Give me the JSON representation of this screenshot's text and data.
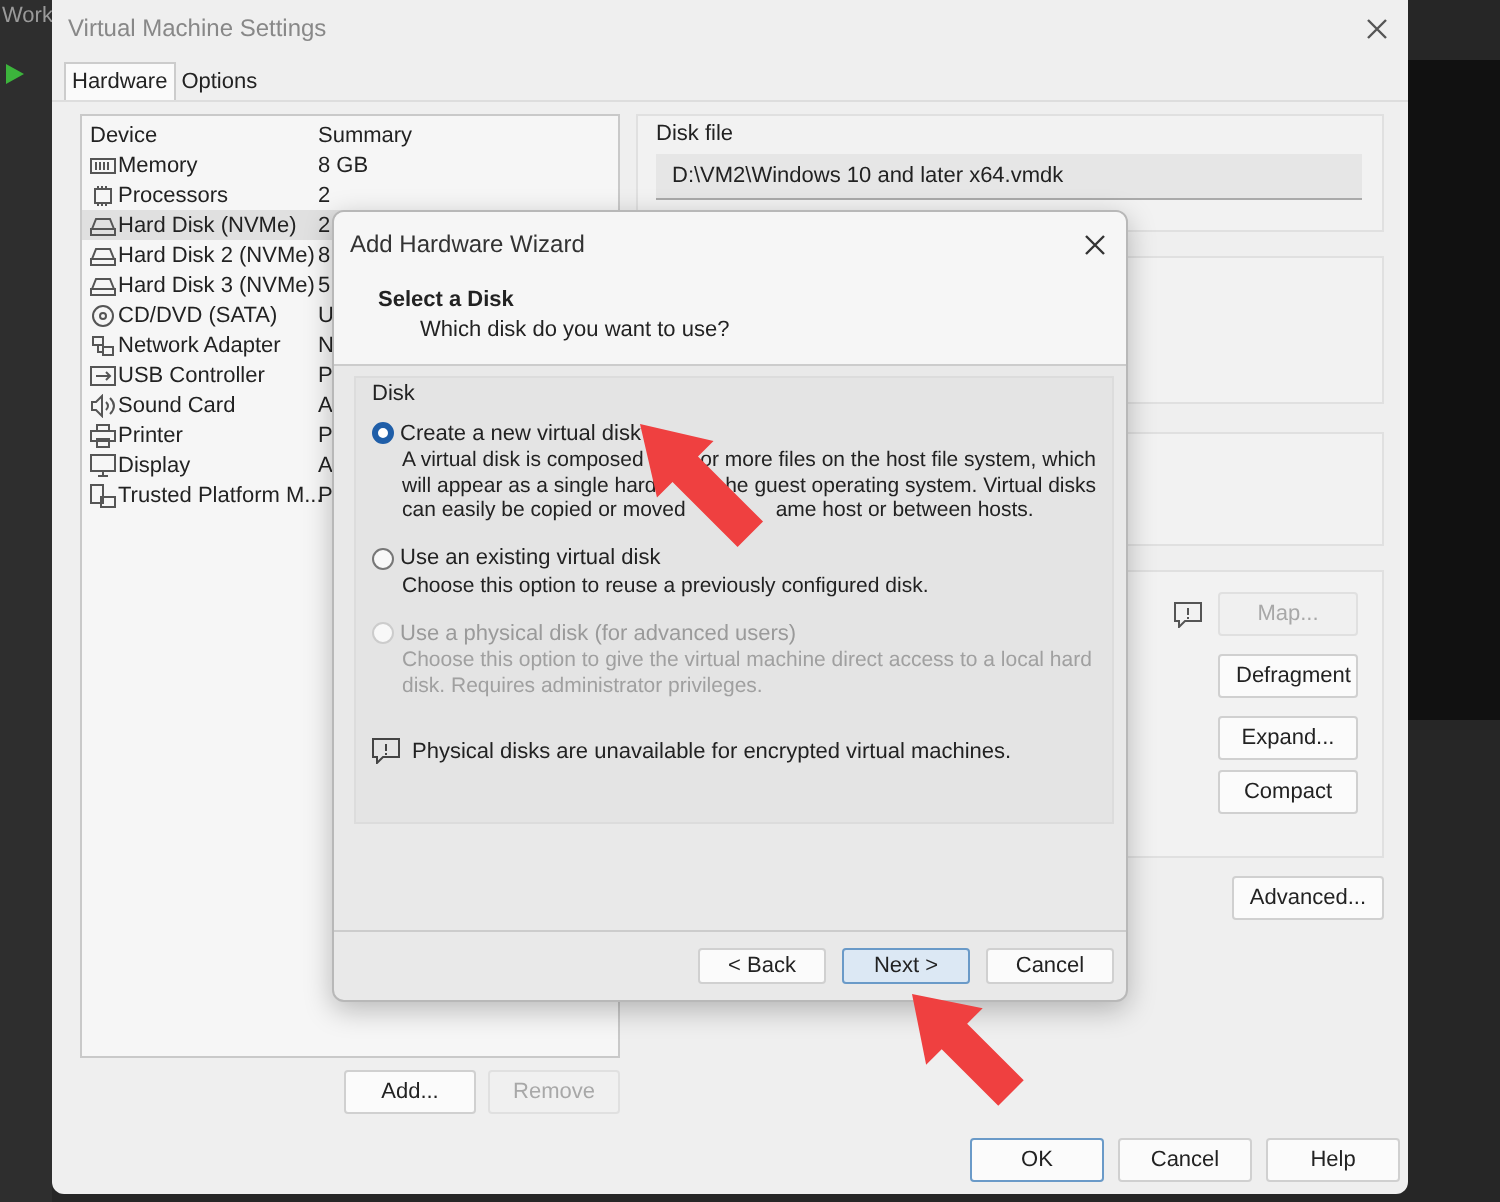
{
  "background_app": {
    "title": "Work"
  },
  "window": {
    "title": "Virtual Machine Settings",
    "tabs": [
      {
        "label": "Hardware",
        "selected": true
      },
      {
        "label": "Options",
        "selected": false
      }
    ],
    "devices": {
      "columns": [
        "Device",
        "Summary"
      ],
      "rows": [
        {
          "kind": "memory",
          "name": "Memory",
          "summary": "8 GB",
          "selected": false
        },
        {
          "kind": "cpu",
          "name": "Processors",
          "summary": "2",
          "selected": false
        },
        {
          "kind": "disk",
          "name": "Hard Disk (NVMe)",
          "summary": "2",
          "selected": true
        },
        {
          "kind": "disk",
          "name": "Hard Disk 2 (NVMe)",
          "summary": "8",
          "selected": false
        },
        {
          "kind": "disk",
          "name": "Hard Disk 3 (NVMe)",
          "summary": "5",
          "selected": false
        },
        {
          "kind": "cd",
          "name": "CD/DVD (SATA)",
          "summary": "U",
          "selected": false
        },
        {
          "kind": "network",
          "name": "Network Adapter",
          "summary": "N",
          "selected": false
        },
        {
          "kind": "usb",
          "name": "USB Controller",
          "summary": "P",
          "selected": false
        },
        {
          "kind": "sound",
          "name": "Sound Card",
          "summary": "A",
          "selected": false
        },
        {
          "kind": "printer",
          "name": "Printer",
          "summary": "P",
          "selected": false
        },
        {
          "kind": "display",
          "name": "Display",
          "summary": "A",
          "selected": false
        },
        {
          "kind": "tpm",
          "name": "Trusted Platform M...",
          "summary": "P",
          "selected": false
        }
      ]
    },
    "list_buttons": [
      {
        "label": "Add...",
        "disabled": false
      },
      {
        "label": "Remove",
        "disabled": true
      }
    ],
    "disk_file": {
      "label": "Disk file",
      "value": "D:\\VM2\\Windows 10 and later x64.vmdk"
    },
    "utility_buttons": [
      {
        "label": "Map...",
        "disabled": true,
        "info": true
      },
      {
        "label": "Defragment",
        "disabled": false,
        "info": false
      },
      {
        "label": "Expand...",
        "disabled": false,
        "info": false
      },
      {
        "label": "Compact",
        "disabled": false,
        "info": false
      }
    ],
    "advanced_button": {
      "label": "Advanced...",
      "disabled": false
    },
    "footer_buttons": [
      {
        "label": "OK",
        "default": true
      },
      {
        "label": "Cancel",
        "default": false
      },
      {
        "label": "Help",
        "default": false
      }
    ]
  },
  "wizard": {
    "title": "Add Hardware Wizard",
    "heading": "Select a Disk",
    "subheading": "Which disk do you want to use?",
    "group_label": "Disk",
    "options": [
      {
        "label": "Create a new virtual disk",
        "selected": true,
        "disabled": false,
        "lines": [
          [
            "A virtual disk is composed",
            "or more files on the host file system, which"
          ],
          [
            "will appear as a single hard",
            "he guest operating system. Virtual disks"
          ],
          [
            "can easily be copied or moved",
            "ame host or between hosts."
          ]
        ]
      },
      {
        "label": "Use an existing virtual disk",
        "selected": false,
        "disabled": false,
        "lines": [
          [
            "Choose this option to reuse a previously configured disk."
          ]
        ]
      },
      {
        "label": "Use a physical disk (for advanced users)",
        "selected": false,
        "disabled": true,
        "lines": [
          [
            "Choose this option to give the virtual machine direct access to a local hard"
          ],
          [
            "disk. Requires administrator privileges."
          ]
        ]
      }
    ],
    "note": "Physical disks are unavailable for encrypted virtual machines.",
    "buttons": [
      {
        "label": "< Back",
        "default": false
      },
      {
        "label": "Next >",
        "default": true
      },
      {
        "label": "Cancel",
        "default": false
      }
    ]
  }
}
